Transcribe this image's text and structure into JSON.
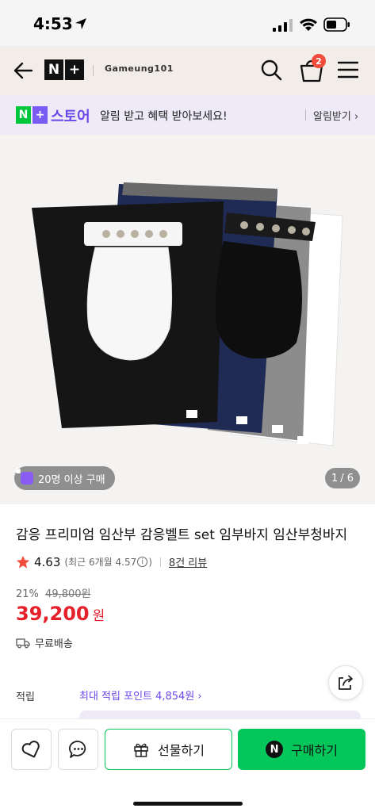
{
  "status_bar": {
    "time": "4:53"
  },
  "header": {
    "logo_n": "N",
    "logo_plus": "+",
    "store_name": "Gameung101",
    "cart_count": "2"
  },
  "banner": {
    "logo_n": "N",
    "logo_plus": "+",
    "store_label": "스토어",
    "message": "알림 받고 혜택 받아보세요!",
    "cta": "알림받기 ›"
  },
  "gallery": {
    "buyers_badge": "20명 이상 구매",
    "counter_current": "1",
    "counter_total": "/ 6"
  },
  "product": {
    "title": "감응 프리미엄 임산부 감응벨트 set 임부바지 임산부청바지",
    "rating": "4.63",
    "rating_recent_prefix": "(최근 6개월 4.57",
    "rating_recent_suffix": ")",
    "review_count": "8건 리뷰",
    "discount_rate": "21%",
    "original_price": "49,800원",
    "sale_price": "39,200",
    "sale_currency": "원",
    "delivery": "무료배송"
  },
  "points": {
    "label": "적립",
    "link": "최대 적립 포인트 4,854원 ›"
  },
  "actions": {
    "gift_label": "선물하기",
    "buy_label": "구매하기",
    "npay_letter": "N"
  },
  "colors": {
    "accent_purple": "#6a47e8",
    "naver_green": "#03c75a",
    "price_red": "#e5202b",
    "badge_red": "#f04b3b"
  },
  "icons": [
    "back-arrow-icon",
    "search-icon",
    "cart-icon",
    "menu-icon",
    "star-icon",
    "info-icon",
    "truck-icon",
    "share-icon",
    "wishlist-icon",
    "talk-icon",
    "gift-icon",
    "npay-icon"
  ]
}
